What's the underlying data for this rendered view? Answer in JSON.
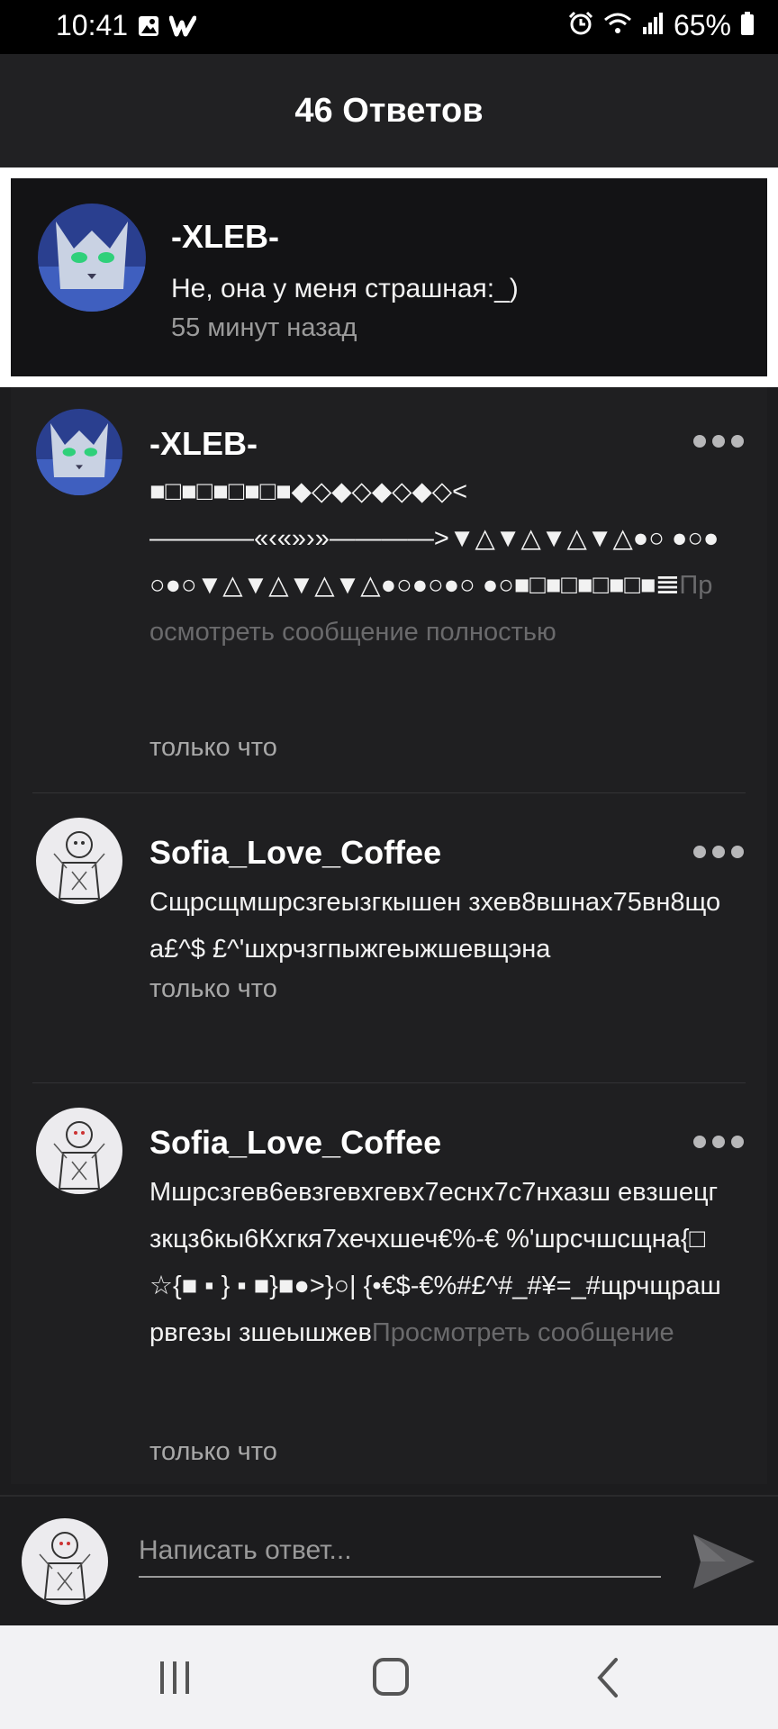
{
  "status_bar": {
    "time": "10:41",
    "battery": "65%",
    "icons": [
      "image-icon",
      "wattpad-icon",
      "alarm-icon",
      "wifi-icon",
      "signal-icon",
      "battery-icon"
    ]
  },
  "header": {
    "title": "46 Ответов"
  },
  "parent_comment": {
    "author": "-XLEB-",
    "text": "Не, она у меня страшная:_)",
    "time": "55 минут назад"
  },
  "replies": [
    {
      "author": "-XLEB-",
      "text": "■□■□■□■□■◆◇◆◇◆◇◆◇< ————«‹«»›»————>▼△▼△▼△▼△●○ ●○●○●○▼△▼△▼△▼△●○●○●○ ●○■□■□■□■□■𝌆",
      "more_label": "Просмотреть сообщение полностью",
      "time": "только что"
    },
    {
      "author": "Sofia_Love_Coffee",
      "text": "Сщрсщмшрсзгеызгкышен зхев8вшнах75вн8щоа£^$ £^'шхрчзгпыжгеыжшевщэна",
      "more_label": "",
      "time": "только что"
    },
    {
      "author": "Sofia_Love_Coffee",
      "text": "Мшрсзгев6евзгевхгевх7еснх7с7нхазш евзшецгзкцз6кы6Кхгкя7хечхшеч€%-€ %'шрсчшсщна{□☆{■ ▪ } ▪ ■}■●>}○| {•€$-€%#£^#_#¥=_#щрчщрашрвгезы зшеышжев",
      "more_label": "Просмотреть сообщение",
      "time": "только что"
    }
  ],
  "compose": {
    "placeholder": "Написать ответ..."
  },
  "colors": {
    "background": "#1c1c1e",
    "highlight_border": "#ffffff",
    "secondary_text": "#9b9b9b",
    "muted_link": "#6a6a6c"
  }
}
